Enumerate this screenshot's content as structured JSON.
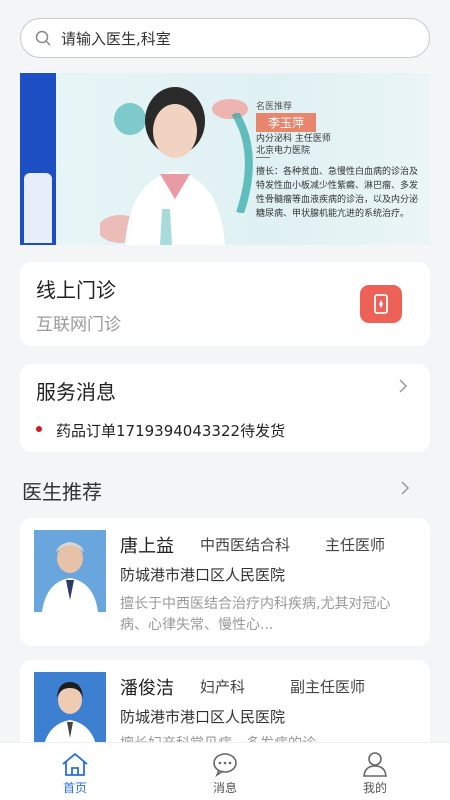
{
  "search": {
    "placeholder": "请输入医生,科室"
  },
  "banner": {
    "tag": "名医推荐",
    "doctor_name": "李玉萍",
    "title": "内分泌科  主任医师",
    "hospital": "北京电力医院",
    "description": "擅长：各种贫血、急慢性白血病的诊治及特发性血小板减少性紫癜、淋巴瘤、多发性骨髓瘤等血液疾病的诊治，以及内分泌糖尿病、甲状腺机能亢进的系统治疗。"
  },
  "online_clinic": {
    "title": "线上门诊",
    "subtitle": "互联网门诊"
  },
  "service_messages": {
    "title": "服务消息",
    "items": [
      {
        "text": "药品订单1719394043322待发货"
      }
    ]
  },
  "doctor_recommend": {
    "title": "医生推荐",
    "doctors": [
      {
        "name": "唐上益",
        "department": "中西医结合科",
        "rank": "主任医师",
        "hospital": "防城港市港口区人民医院",
        "intro": "擅长于中西医结合治疗内科疾病,尤其对冠心病、心律失常、慢性心..."
      },
      {
        "name": "潘俊洁",
        "department": "妇产科",
        "rank": "副主任医师",
        "hospital": "防城港市港口区人民医院",
        "intro": "擅长妇产科常见病、多发病的诊..."
      }
    ]
  },
  "tabbar": {
    "items": [
      {
        "label": "首页",
        "icon": "home-icon",
        "active": true
      },
      {
        "label": "消息",
        "icon": "chat-icon",
        "active": false
      },
      {
        "label": "我的",
        "icon": "user-icon",
        "active": false
      }
    ]
  },
  "colors": {
    "accent": "#2a6ed8",
    "clinic_button": "#ee6157",
    "banner_name_bg": "#e7866d",
    "dot": "#d31d1d"
  }
}
